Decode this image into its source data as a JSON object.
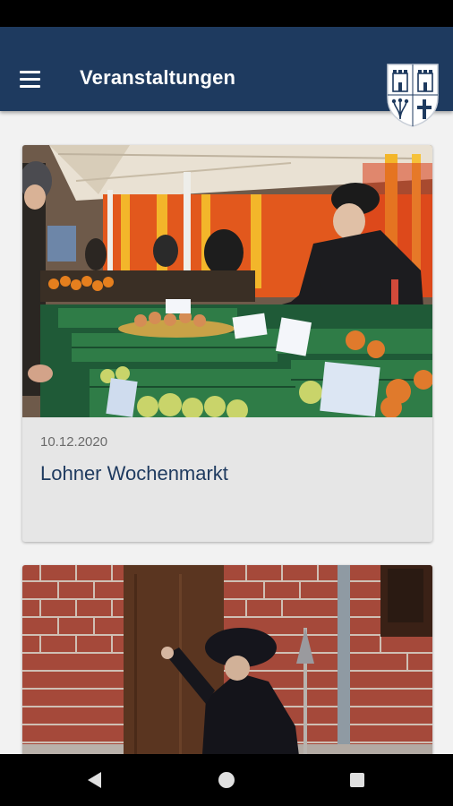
{
  "app_bar": {
    "title": "Veranstaltungen",
    "menu_icon": "hamburger-menu-icon",
    "logo_icon": "city-coat-of-arms-icon",
    "background_color": "#1e3a5f"
  },
  "events": [
    {
      "date": "10.12.2020",
      "title": "Lohner Wochenmarkt",
      "image": "market-stall-photo"
    },
    {
      "date": "",
      "title": "",
      "image": "night-watchman-photo"
    }
  ],
  "nav_bar": {
    "back_icon": "back-triangle-icon",
    "home_icon": "home-circle-icon",
    "recents_icon": "recents-square-icon"
  }
}
